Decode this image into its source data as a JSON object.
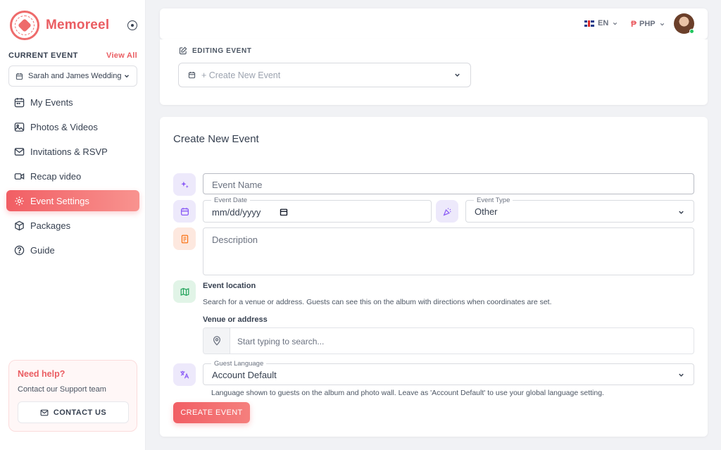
{
  "brand": {
    "name": "Memoreel"
  },
  "sidebar": {
    "current_event_label": "CURRENT EVENT",
    "view_all": "View All",
    "current_event": "Sarah and James Wedding",
    "items": [
      {
        "label": "My Events",
        "icon": "calendar-icon"
      },
      {
        "label": "Photos & Videos",
        "icon": "image-icon"
      },
      {
        "label": "Invitations & RSVP",
        "icon": "mail-icon"
      },
      {
        "label": "Recap video",
        "icon": "video-icon"
      },
      {
        "label": "Event Settings",
        "icon": "gear-icon",
        "active": true
      },
      {
        "label": "Packages",
        "icon": "box-icon"
      },
      {
        "label": "Guide",
        "icon": "help-circle-icon"
      }
    ],
    "help": {
      "title": "Need help?",
      "subtitle": "Contact our Support team",
      "button": "CONTACT US"
    }
  },
  "topbar": {
    "language": "EN",
    "currency_symbol": "₱",
    "currency": "PHP"
  },
  "editing": {
    "label": "EDITING EVENT",
    "select_value": "+ Create New Event"
  },
  "form": {
    "title": "Create New Event",
    "event_name_placeholder": "Event Name",
    "event_date_label": "Event Date",
    "event_date_value": "mm/dd/yyyy",
    "event_type_label": "Event Type",
    "event_type_value": "Other",
    "description_placeholder": "Description",
    "location_title": "Event location",
    "location_sub": "Search for a venue or address. Guests can see this on the album with directions when coordinates are set.",
    "venue_label": "Venue or address",
    "venue_placeholder": "Start typing to search...",
    "guest_language_label": "Guest Language",
    "guest_language_value": "Account Default",
    "guest_language_help": "Language shown to guests on the album and photo wall. Leave as 'Account Default' to use your global language setting.",
    "submit": "CREATE EVENT"
  },
  "colors": {
    "accent": "#ea5d62",
    "active_start": "#f15e64",
    "active_end": "#f8938f"
  }
}
